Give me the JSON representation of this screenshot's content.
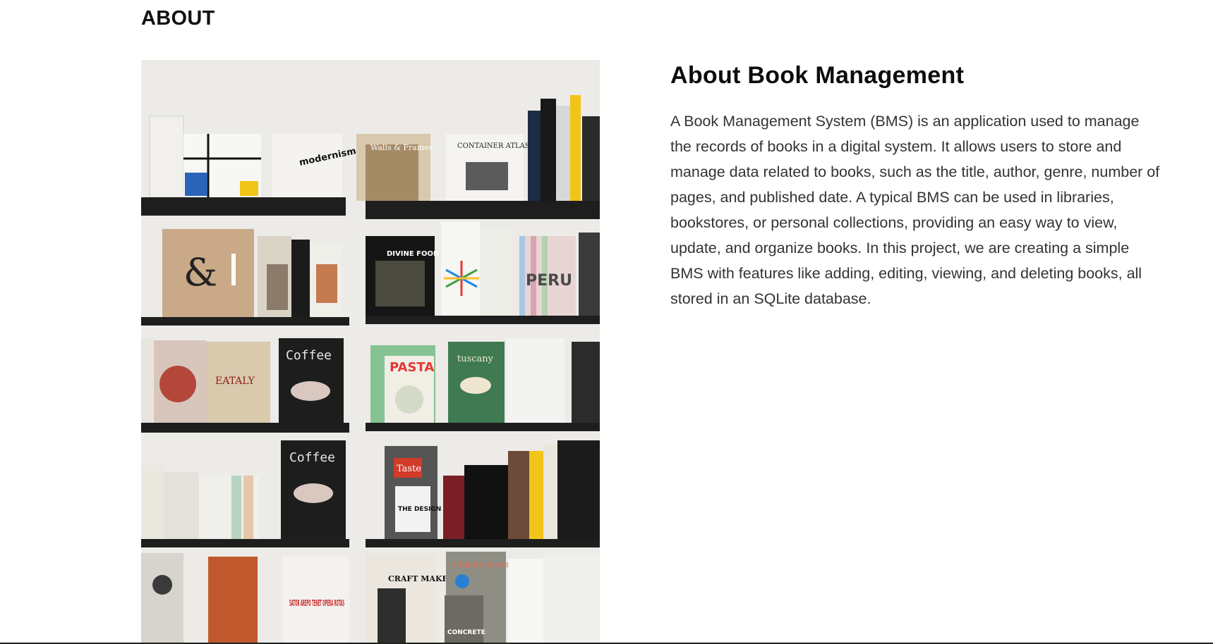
{
  "section": {
    "label": "ABOUT"
  },
  "about": {
    "title": "About Book Management",
    "body": "A Book Management System (BMS) is an application used to manage the records of books in a digital system. It allows users to store and manage data related to books, such as the title, author, genre, number of pages, and published date. A typical BMS can be used in libraries, bookstores, or personal collections, providing an easy way to view, update, and organize books. In this project, we are creating a simple BMS with features like adding, editing, viewing, and deleting books, all stored in an SQLite database."
  },
  "image": {
    "subject": "bookshelf-photo",
    "book_covers": {
      "modernism": "modernism",
      "walls_frames": "Walls & Frames",
      "container_atlas": "CONTAINER ATLAS",
      "divine_food": "DIVINE FOOD",
      "peru": "PERU",
      "eataly": "EATALY",
      "coffee_1": "Coffee",
      "pasta": "PASTA",
      "tuscany": "tuscany",
      "coffee_2": "Coffee",
      "taste": "Taste",
      "design_book": "THE DESIGN BOOK",
      "craft_makers": "CRAFT MAKERS",
      "vitamin_green": "vitamin green",
      "concrete": "CONCRETE",
      "sator": "SATOR AREPO TENET OPERA ROTAS"
    }
  },
  "colors": {
    "shelf": "#1e1e1e",
    "wall": "#ecebe8",
    "accent_blue": "#2b63b8",
    "accent_yellow": "#f0c419"
  }
}
